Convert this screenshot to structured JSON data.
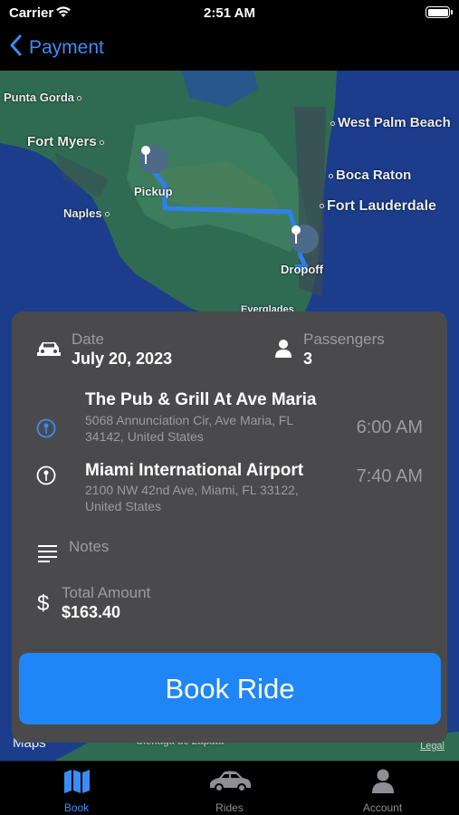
{
  "status_bar": {
    "carrier": "Carrier",
    "time": "2:51 AM"
  },
  "nav": {
    "back_label": "Payment"
  },
  "map": {
    "cities": {
      "punta_gorda": "Punta Gorda",
      "fort_myers": "Fort Myers",
      "naples": "Naples",
      "west_palm_beach": "West Palm Beach",
      "boca_raton": "Boca Raton",
      "fort_lauderdale": "Fort Lauderdale",
      "everglades": "Everglades"
    },
    "pickup_label": "Pickup",
    "dropoff_label": "Dropoff",
    "route_color": "#2f80ed",
    "water_color": "#1b3d8c",
    "land_color": "#2f6a52",
    "attribution": "Maps",
    "legal": "Legal",
    "bottom_label": "Cienaga de Zapata"
  },
  "booking": {
    "date_label": "Date",
    "date_value": "July 20, 2023",
    "passengers_label": "Passengers",
    "passengers_value": "3",
    "pickup": {
      "name": "The Pub & Grill At Ave Maria",
      "address": "5068 Annunciation Cir, Ave Maria, FL 34142, United States",
      "time": "6:00 AM"
    },
    "dropoff": {
      "name": "Miami International Airport",
      "address": "2100 NW 42nd Ave, Miami, FL 33122, United States",
      "time": "7:40 AM"
    },
    "notes_label": "Notes",
    "total_label": "Total Amount",
    "total_value": "$163.40",
    "book_button": "Book Ride"
  },
  "tabs": [
    {
      "label": "Book",
      "icon": "map-icon",
      "active": true
    },
    {
      "label": "Rides",
      "icon": "car-icon",
      "active": false
    },
    {
      "label": "Account",
      "icon": "person-icon",
      "active": false
    }
  ],
  "colors": {
    "accent": "#1f86f7",
    "card": "#4a4a4c"
  }
}
